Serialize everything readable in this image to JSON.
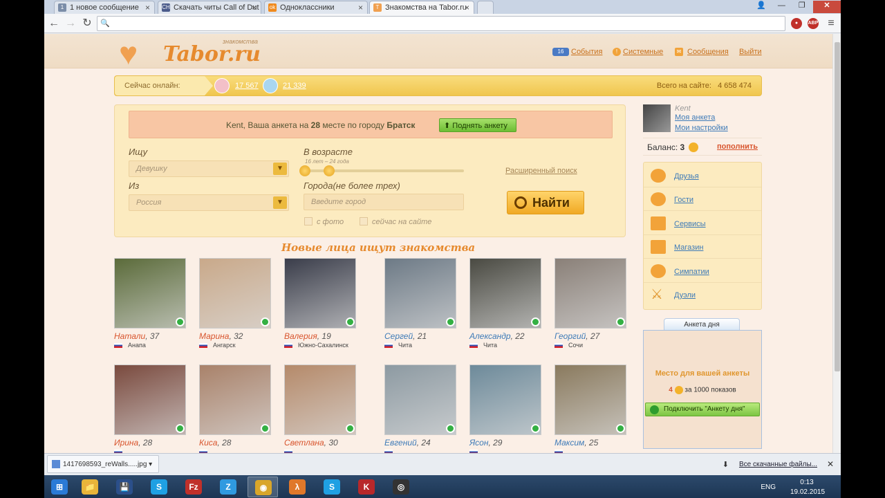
{
  "tabs": [
    {
      "title": "1 новое сообщение",
      "icon": "1"
    },
    {
      "title": "Скачать читы Call of Dut",
      "icon": "CH"
    },
    {
      "title": "Одноклассники",
      "icon": "ok"
    },
    {
      "title": "Знакомства на Tabor.ru",
      "icon": "T"
    }
  ],
  "address": {
    "value": ""
  },
  "site": {
    "brand": "Tabor.ru",
    "brand_sub": "знакомства",
    "header_links": {
      "events_count": "16",
      "events": "События",
      "system": "Системные",
      "messages": "Сообщения",
      "exit": "Выйти"
    },
    "online": {
      "label": "Сейчас онлайн:",
      "female": "17 567",
      "male": "21 339",
      "total_label": "Всего на сайте:",
      "total": "4 658 474"
    },
    "notice": {
      "pre": "Kent, Ваша анкета на",
      "place": "28",
      "mid": "месте по городу",
      "city": "Братск",
      "button": "Поднять анкету"
    },
    "search": {
      "seek_label": "Ищу",
      "seek_value": "Девушку",
      "age_label": "В возрасте",
      "age_range": "16 лет – 24 года",
      "from_label": "Из",
      "from_value": "Россия",
      "cities_label": "Города(не более трех)",
      "city_placeholder": "Введите город",
      "with_photo": "с фото",
      "online_now": "сейчас на сайте",
      "advanced": "Расширенный поиск",
      "find": "Найти"
    },
    "new_faces_heading": "Новые лица ищут знакомства",
    "profiles": [
      {
        "name": "Натали",
        "age": ", 37",
        "city": "Анапа",
        "gender": "f",
        "color": "#5b6b3a"
      },
      {
        "name": "Марина",
        "age": ", 32",
        "city": "Ангарск",
        "gender": "f",
        "color": "#c9a98a"
      },
      {
        "name": "Валерия",
        "age": ", 19",
        "city": "Южно-Сахалинск",
        "gender": "f",
        "color": "#3a3d4a"
      },
      {
        "name": "Сергей",
        "age": ", 21",
        "city": "Чита",
        "gender": "m",
        "color": "#6d7a86"
      },
      {
        "name": "Александр",
        "age": ", 22",
        "city": "Чита",
        "gender": "m",
        "color": "#4a4a42"
      },
      {
        "name": "Георгий",
        "age": ", 27",
        "city": "Сочи",
        "gender": "m",
        "color": "#8a8078"
      },
      {
        "name": "Ирина",
        "age": ", 28",
        "city": "",
        "gender": "f",
        "color": "#7a4a3e"
      },
      {
        "name": "Киса",
        "age": ", 28",
        "city": "",
        "gender": "f",
        "color": "#a9826a"
      },
      {
        "name": "Светлана",
        "age": ", 30",
        "city": "",
        "gender": "f",
        "color": "#b58a6a"
      },
      {
        "name": "Евгений",
        "age": ", 24",
        "city": "",
        "gender": "m",
        "color": "#8d9aa2"
      },
      {
        "name": "Ясон",
        "age": ", 29",
        "city": "",
        "gender": "m",
        "color": "#6d8a9a"
      },
      {
        "name": "Максим",
        "age": ", 25",
        "city": "",
        "gender": "m",
        "color": "#8a7a5e"
      }
    ],
    "user": {
      "nick": "Kent",
      "my_profile": "Моя анкета",
      "my_settings": "Мои настройки"
    },
    "balance": {
      "label": "Баланс:",
      "value": "3",
      "topup": "пополнить"
    },
    "menu": [
      "Друзья",
      "Гости",
      "Сервисы",
      "Магазин",
      "Симпатии",
      "Дуэли"
    ],
    "day": {
      "title": "Анкета дня",
      "place": "Место для вашей анкеты",
      "cost_num": "4",
      "cost_text": "за 1000 показов",
      "button": "Подключить \"Анкету дня\""
    }
  },
  "download": {
    "file": "1417698593_reWalls.....jpg",
    "all": "Все скачанные файлы..."
  },
  "tray": {
    "lang": "ENG",
    "time": "0:13",
    "date": "19.02.2015"
  },
  "taskbar": [
    "windows",
    "explorer",
    "save",
    "skype",
    "filezilla",
    "zona",
    "chrome",
    "halflife",
    "skype2",
    "kaspersky",
    "obs"
  ]
}
